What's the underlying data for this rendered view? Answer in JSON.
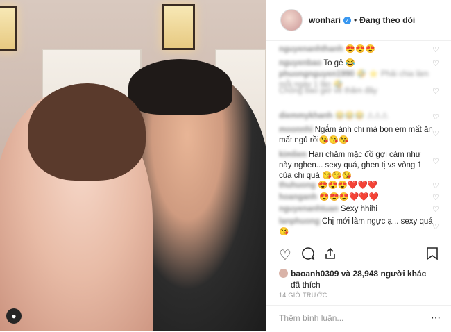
{
  "post": {
    "username": "wonhari",
    "follow_status": "Đang theo dõi",
    "liked_by_user": "baoanh0309",
    "likes_text": "và 28,948 người khác",
    "likes_suffix": "đã thích",
    "timestamp": "14 GIỜ TRƯỚC",
    "comment_placeholder": "Thêm bình luận..."
  },
  "comments": [
    {
      "user": "nguyenanhthanh",
      "text": "😍😍😍"
    },
    {
      "user": "nguyenbao",
      "text": "To gê 😂"
    },
    {
      "user": "phuongnguyen1990",
      "text": "🤣 ⭐ Phải chia làm mỗi ngày 1 lần 🤣"
    },
    {
      "user": "",
      "text": "Chồng bao giờ về thăm đây"
    },
    {
      "user": "diemmykhanh",
      "text": "😂😂😂 ⚠⚠⚠"
    },
    {
      "user": "moonnhi",
      "text": "Ngắm ảnh chị mà bọn em mất ăn mất ngủ rồi😘😘😘"
    },
    {
      "user": "kimlien",
      "text": "Hari chăm mặc đồ gợi cảm như này nghen... sexy quá, ghen tị vs vòng 1 của chị quá 😘😘😘"
    },
    {
      "user": "thuhuong",
      "text": "😍😍😍❤️❤️❤️"
    },
    {
      "user": "hoanganh",
      "text": "😍😍😍❤️❤️❤️"
    },
    {
      "user": "nguyenanhtuan",
      "text": "Sexy hhihi"
    },
    {
      "user": "lanphuong",
      "text": "Chị mới làm ngực ạ... sexy quá😘"
    }
  ],
  "icons": {
    "verified": "verified-badge-icon",
    "heart": "heart-icon",
    "comment": "comment-icon",
    "share": "share-icon",
    "save": "bookmark-icon",
    "more": "more-icon",
    "user": "user-tag-icon"
  }
}
